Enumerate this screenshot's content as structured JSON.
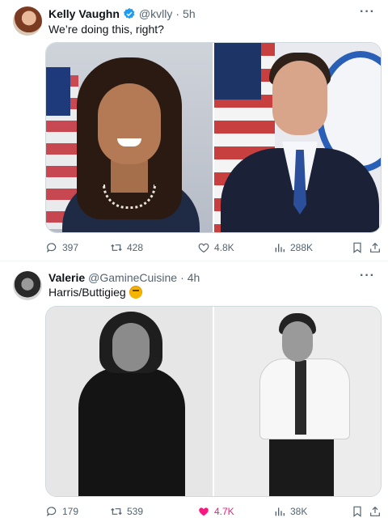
{
  "tweets": [
    {
      "name": "Kelly Vaughn",
      "verified": true,
      "handle": "@kvlly",
      "sep": "·",
      "time": "5h",
      "text": "We’re doing this, right?",
      "stats": {
        "replies": "397",
        "retweets": "428",
        "likes": "4.8K",
        "views": "288K"
      },
      "liked": false
    },
    {
      "name": "Valerie",
      "verified": false,
      "handle": "@GamineCuisine",
      "sep": "·",
      "time": "4h",
      "text": "Harris/Buttigieg",
      "stats": {
        "replies": "179",
        "retweets": "539",
        "likes": "4.7K",
        "views": "38K"
      },
      "liked": true
    }
  ],
  "more_label": "···",
  "colors": {
    "accent": "#1d9bf0",
    "liked": "#f91880",
    "muted": "#536471"
  },
  "icons": [
    "reply-icon",
    "retweet-icon",
    "like-icon",
    "views-icon",
    "bookmark-icon",
    "share-icon",
    "verified-icon",
    "more-icon"
  ]
}
